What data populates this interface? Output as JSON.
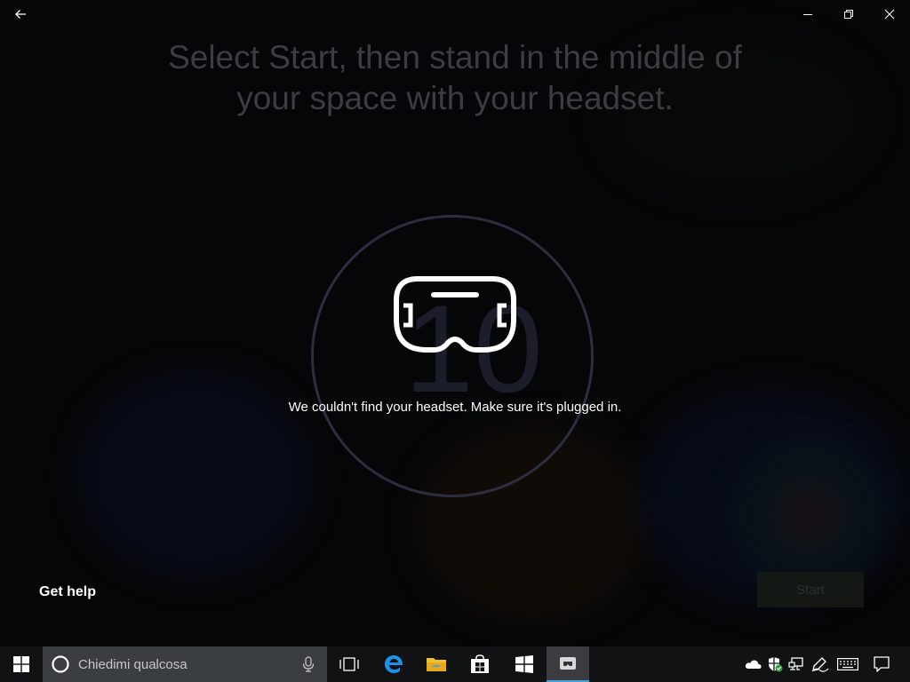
{
  "window": {
    "back_icon": "back-arrow-icon",
    "minimize_icon": "minimize-icon",
    "restore_icon": "restore-icon",
    "close_icon": "close-icon"
  },
  "main": {
    "title_line1": "Select Start, then stand in the middle of",
    "title_line2": "your space with your headset.",
    "countdown": "10",
    "headset_icon": "vr-headset-icon",
    "message": "We couldn't find your headset. Make sure it's plugged in.",
    "get_help": "Get help",
    "start_label": "Start"
  },
  "taskbar": {
    "search_placeholder": "Chiedimi qualcosa",
    "icons": [
      "windows-start-icon",
      "cortana-icon",
      "microphone-icon",
      "task-view-icon",
      "edge-icon",
      "file-explorer-icon",
      "store-icon",
      "mixed-reality-portal-icon",
      "active-app-icon"
    ],
    "tray_icons": [
      "onedrive-icon",
      "windows-defender-icon",
      "network-icon",
      "pen-ink-icon",
      "touch-keyboard-icon",
      "action-center-icon"
    ]
  },
  "colors": {
    "background": "#050607",
    "taskbar": "#101213",
    "search_box": "#3b3e41",
    "accent_edge": "#1e90e6",
    "accent_explorer": "#f2c12e",
    "active_underline": "#46a1d4"
  }
}
